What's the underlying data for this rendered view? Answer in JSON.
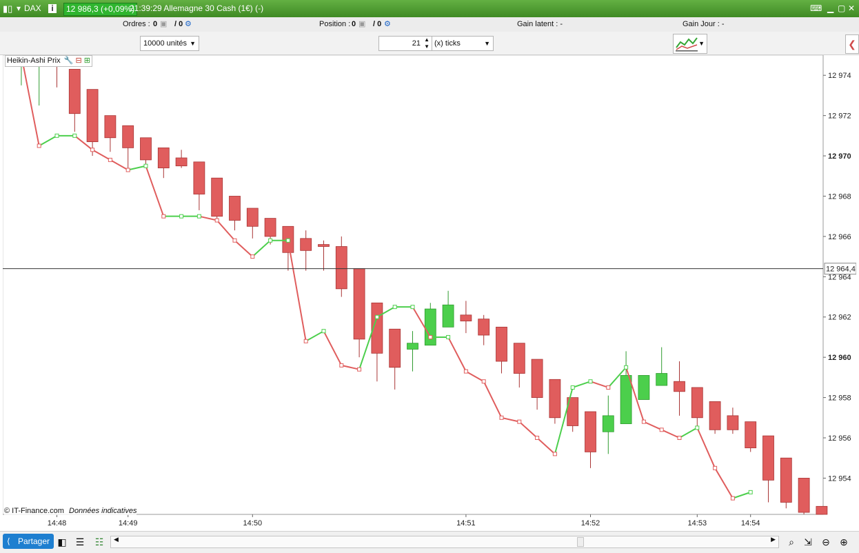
{
  "titlebar": {
    "symbol": "DAX",
    "price_badge": "12 986,3 (+0,09%)",
    "title": "21:39:29 Allemagne 30 Cash (1€) (-)"
  },
  "infobar": {
    "ordres_label": "Ordres :",
    "ordres_value": "0",
    "ordres_value2": "/ 0",
    "position_label": "Position :",
    "position_value": "0",
    "position_value2": "/ 0",
    "gain_latent": "Gain latent :  -",
    "gain_jour": "Gain Jour :  -"
  },
  "controls": {
    "units": "10000 unités",
    "ticks_value": "21",
    "ticks_unit": "(x) ticks"
  },
  "indicator_label": "Heikin-Ashi Prix",
  "credit": {
    "company": "© IT-Finance.com",
    "note": "Données indicatives"
  },
  "share_label": "Partager",
  "chart_data": {
    "type": "candlestick",
    "ylim": [
      12952.2,
      12975
    ],
    "y_ticks": [
      12974,
      12972,
      12970,
      12968,
      12966,
      12964,
      12962,
      12960,
      12958,
      12956,
      12954
    ],
    "y_tick_labels": [
      "12 974",
      "12 972",
      "12 970",
      "12 968",
      "12 966",
      "12 964",
      "12 962",
      "12 960",
      "12 958",
      "12 956",
      "12 954"
    ],
    "y_bold_ticks": [
      "12 970",
      "12 960"
    ],
    "current_price": 12964.4,
    "current_price_label": "12 964,4",
    "x_ticks": [
      {
        "label": "14:48",
        "i": 2
      },
      {
        "label": "14:49",
        "i": 6
      },
      {
        "label": "14:50",
        "i": 13
      },
      {
        "label": "14:51",
        "i": 25
      },
      {
        "label": "14:52",
        "i": 32
      },
      {
        "label": "14:53",
        "i": 38
      },
      {
        "label": "14:54",
        "i": 41
      }
    ],
    "colors": {
      "up": "#4ccf4c",
      "down": "#e05d5d",
      "up_border": "#2e9b2e",
      "down_border": "#a83434"
    },
    "candles": [
      {
        "o": 12974.5,
        "h": 12974.6,
        "l": 12973.5,
        "c": 12974.5
      },
      {
        "o": 12974.6,
        "h": 12974.6,
        "l": 12972.5,
        "c": 12974.6
      },
      {
        "o": 12974.6,
        "h": 12974.6,
        "l": 12973.4,
        "c": 12974.5
      },
      {
        "o": 12974.3,
        "h": 12974.3,
        "l": 12971.2,
        "c": 12972.1
      },
      {
        "o": 12973.3,
        "h": 12973.3,
        "l": 12970,
        "c": 12970.7
      },
      {
        "o": 12972,
        "h": 12972,
        "l": 12970.2,
        "c": 12970.9
      },
      {
        "o": 12971.5,
        "h": 12971.5,
        "l": 12969.3,
        "c": 12970.4
      },
      {
        "o": 12970.9,
        "h": 12970.9,
        "l": 12969.5,
        "c": 12969.8
      },
      {
        "o": 12970.4,
        "h": 12970.4,
        "l": 12968.9,
        "c": 12969.4
      },
      {
        "o": 12969.9,
        "h": 12970.3,
        "l": 12969.4,
        "c": 12969.5
      },
      {
        "o": 12969.7,
        "h": 12969.7,
        "l": 12967.3,
        "c": 12968.1
      },
      {
        "o": 12968.9,
        "h": 12968.9,
        "l": 12966.9,
        "c": 12967
      },
      {
        "o": 12968,
        "h": 12968,
        "l": 12966.3,
        "c": 12966.8
      },
      {
        "o": 12967.4,
        "h": 12967.4,
        "l": 12965.9,
        "c": 12966.5
      },
      {
        "o": 12966.9,
        "h": 12966.9,
        "l": 12965.6,
        "c": 12966
      },
      {
        "o": 12966.5,
        "h": 12966.5,
        "l": 12964.3,
        "c": 12965.2
      },
      {
        "o": 12965.9,
        "h": 12966.3,
        "l": 12964.3,
        "c": 12965.3
      },
      {
        "o": 12965.6,
        "h": 12965.8,
        "l": 12964.3,
        "c": 12965.5
      },
      {
        "o": 12965.5,
        "h": 12966,
        "l": 12963,
        "c": 12963.4
      },
      {
        "o": 12964.4,
        "h": 12964.4,
        "l": 12960,
        "c": 12960.9
      },
      {
        "o": 12962.7,
        "h": 12962.7,
        "l": 12958.8,
        "c": 12960.2
      },
      {
        "o": 12961.4,
        "h": 12961.4,
        "l": 12958.4,
        "c": 12959.5
      },
      {
        "o": 12960.4,
        "h": 12961.3,
        "l": 12959.3,
        "c": 12960.7
      },
      {
        "o": 12960.6,
        "h": 12962.7,
        "l": 12960.6,
        "c": 12962.4
      },
      {
        "o": 12961.5,
        "h": 12963.3,
        "l": 12961.5,
        "c": 12962.6
      },
      {
        "o": 12962.1,
        "h": 12962.8,
        "l": 12961.2,
        "c": 12961.8
      },
      {
        "o": 12961.9,
        "h": 12962.1,
        "l": 12960.6,
        "c": 12961.1
      },
      {
        "o": 12961.5,
        "h": 12961.5,
        "l": 12959.2,
        "c": 12959.8
      },
      {
        "o": 12960.7,
        "h": 12960.7,
        "l": 12958.5,
        "c": 12959.2
      },
      {
        "o": 12959.9,
        "h": 12959.9,
        "l": 12957.4,
        "c": 12958
      },
      {
        "o": 12958.9,
        "h": 12958.9,
        "l": 12956.7,
        "c": 12957
      },
      {
        "o": 12958,
        "h": 12958,
        "l": 12956.3,
        "c": 12956.6
      },
      {
        "o": 12957.3,
        "h": 12957.3,
        "l": 12954.5,
        "c": 12955.3
      },
      {
        "o": 12956.3,
        "h": 12958.1,
        "l": 12955.2,
        "c": 12957.1
      },
      {
        "o": 12956.7,
        "h": 12960.3,
        "l": 12956.7,
        "c": 12959.1
      },
      {
        "o": 12957.9,
        "h": 12959.1,
        "l": 12957.9,
        "c": 12959.1
      },
      {
        "o": 12958.6,
        "h": 12960.5,
        "l": 12958.6,
        "c": 12959.2
      },
      {
        "o": 12958.8,
        "h": 12959.8,
        "l": 12957.1,
        "c": 12958.3
      },
      {
        "o": 12958.5,
        "h": 12958.5,
        "l": 12956.5,
        "c": 12957
      },
      {
        "o": 12957.8,
        "h": 12957.8,
        "l": 12956.2,
        "c": 12956.4
      },
      {
        "o": 12957.1,
        "h": 12957.5,
        "l": 12956.2,
        "c": 12956.4
      },
      {
        "o": 12956.8,
        "h": 12956.8,
        "l": 12955.3,
        "c": 12955.5
      },
      {
        "o": 12956.1,
        "h": 12956.1,
        "l": 12952.8,
        "c": 12953.9
      },
      {
        "o": 12955,
        "h": 12955,
        "l": 12952.5,
        "c": 12952.8
      },
      {
        "o": 12954,
        "h": 12954,
        "l": 12952.2,
        "c": 12952.3
      },
      {
        "o": 12952.6,
        "h": 12952.6,
        "l": 12952.2,
        "c": 12952.2
      }
    ],
    "line": [
      12975,
      12970.5,
      12971,
      12971,
      12970.3,
      12969.8,
      12969.3,
      12969.5,
      12967,
      12967,
      12967,
      12966.8,
      12965.8,
      12965,
      12965.8,
      12965.8,
      12960.8,
      12961.3,
      12959.6,
      12959.4,
      12962,
      12962.5,
      12962.5,
      12961,
      12961,
      12959.3,
      12958.8,
      12957,
      12956.8,
      12956,
      12955.2,
      12958.5,
      12958.8,
      12958.5,
      12959.5,
      12956.8,
      12956.4,
      12956,
      12956.5,
      12954.5,
      12953,
      12953.3
    ]
  }
}
